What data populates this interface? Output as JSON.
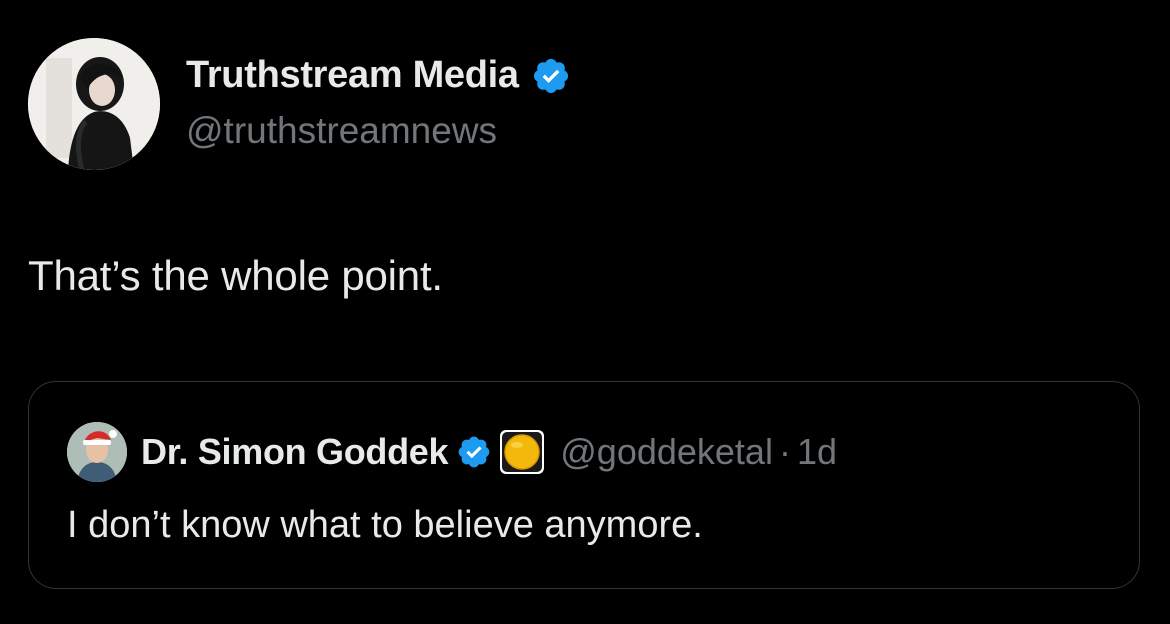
{
  "author": {
    "name": "Truthstream Media",
    "handle": "@truthstreamnews",
    "avatar_icon": "user-photo-avatar",
    "verified_icon": "verified-badge-icon"
  },
  "tweet": {
    "text": "That’s the whole point."
  },
  "quoted_tweet": {
    "author_name": "Dr. Simon Goddek",
    "handle": "@goddeketal",
    "separator": "·",
    "time": "1d",
    "text": "I don’t know what to believe anymore.",
    "avatar_icon": "user-photo-avatar",
    "verified_icon": "verified-badge-icon",
    "affiliate_badge_icon": "yellow-circle-badge-icon"
  },
  "colors": {
    "background": "#000000",
    "primary_text": "#e7e9ea",
    "secondary_text": "#71767b",
    "verified_blue": "#1d9bf0",
    "border": "#2f3336"
  }
}
